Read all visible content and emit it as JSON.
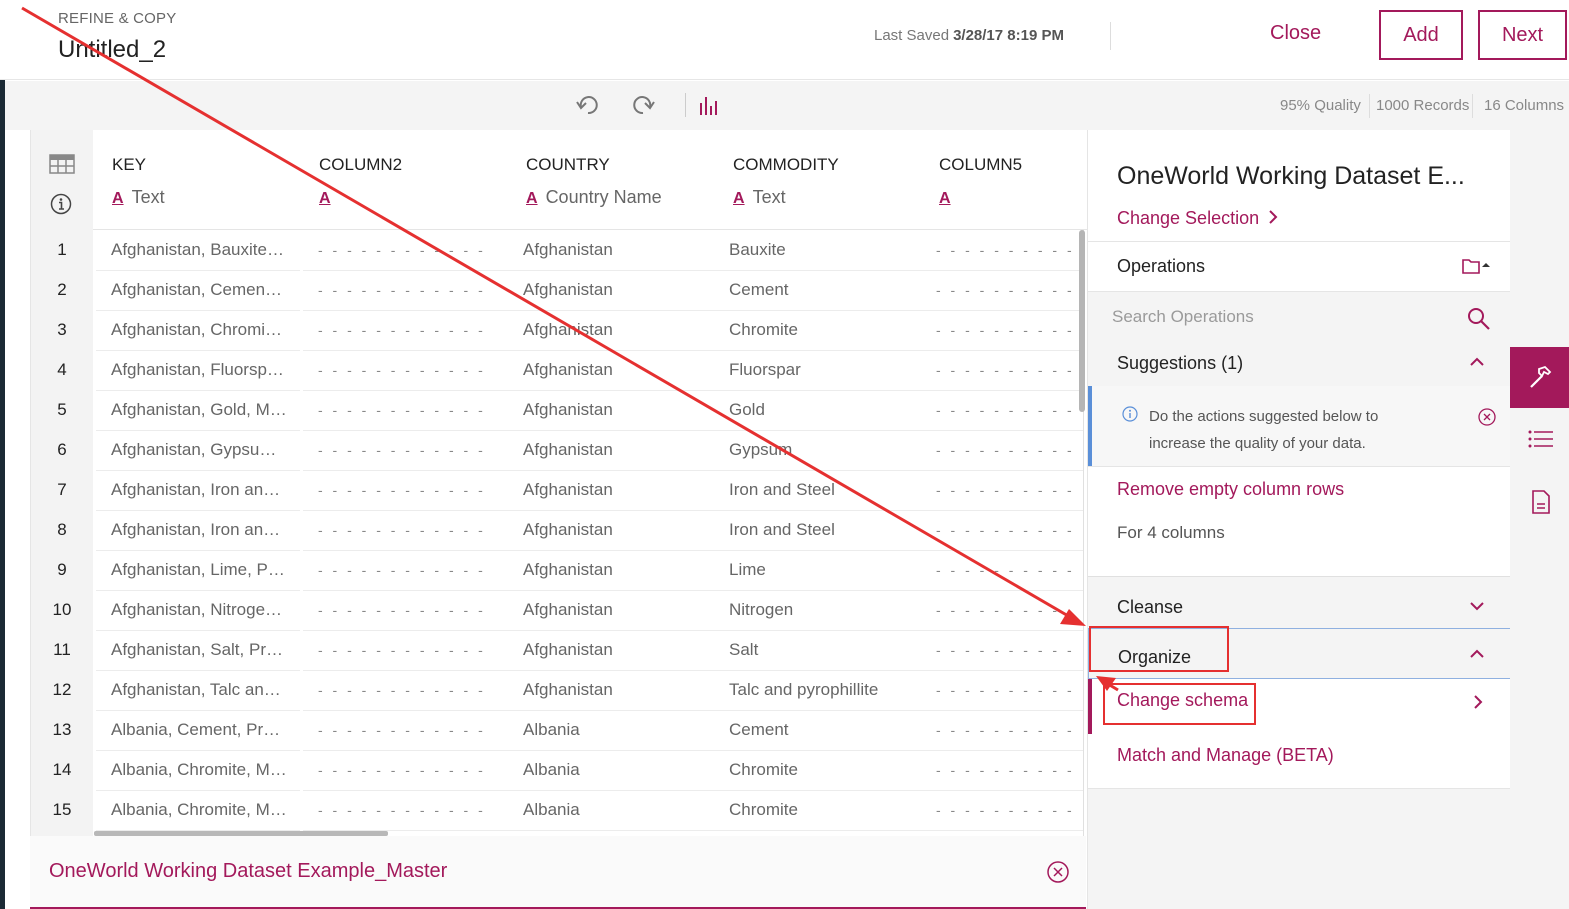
{
  "header": {
    "kicker": "REFINE & COPY",
    "title": "Untitled_2",
    "last_saved_label": "Last Saved",
    "last_saved_value": "3/28/17 8:19 PM",
    "close_label": "Close",
    "add_label": "Add",
    "next_label": "Next"
  },
  "toolbar": {
    "undo_icon": "undo-icon",
    "redo_icon": "redo-icon",
    "chart_icon": "bar-chart-icon",
    "quality": "95% Quality",
    "records": "1000 Records",
    "columns": "16 Columns"
  },
  "table": {
    "columns": [
      {
        "name": "KEY",
        "glyph": "A",
        "type": "Text"
      },
      {
        "name": "COLUMN2",
        "glyph": "A",
        "type": ""
      },
      {
        "name": "COUNTRY",
        "glyph": "A",
        "type": "Country Name"
      },
      {
        "name": "COMMODITY",
        "glyph": "A",
        "type": "Text"
      },
      {
        "name": "COLUMN5",
        "glyph": "A",
        "type": ""
      }
    ],
    "rows": [
      {
        "n": "1",
        "key": "Afghanistan, Bauxite…",
        "col2": "- - - - - - - - - - - - - -",
        "country": "Afghanistan",
        "commodity": "Bauxite",
        "col5": "- - - - - - - - - - - - -"
      },
      {
        "n": "2",
        "key": "Afghanistan, Cemen…",
        "col2": "- - - - - - - - - - - - - -",
        "country": "Afghanistan",
        "commodity": "Cement",
        "col5": "- - - - - - - - - - - - -"
      },
      {
        "n": "3",
        "key": "Afghanistan, Chromi…",
        "col2": "- - - - - - - - - - - - - -",
        "country": "Afghanistan",
        "commodity": "Chromite",
        "col5": "- - - - - - - - - - - - -"
      },
      {
        "n": "4",
        "key": "Afghanistan, Fluorsp…",
        "col2": "- - - - - - - - - - - - - -",
        "country": "Afghanistan",
        "commodity": "Fluorspar",
        "col5": "- - - - - - - - - - - - -"
      },
      {
        "n": "5",
        "key": "Afghanistan, Gold, M…",
        "col2": "- - - - - - - - - - - - - -",
        "country": "Afghanistan",
        "commodity": "Gold",
        "col5": "- - - - - - - - - - - - -"
      },
      {
        "n": "6",
        "key": "Afghanistan, Gypsu…",
        "col2": "- - - - - - - - - - - - - -",
        "country": "Afghanistan",
        "commodity": "Gypsum",
        "col5": "- - - - - - - - - - - - -"
      },
      {
        "n": "7",
        "key": "Afghanistan, Iron an…",
        "col2": "- - - - - - - - - - - - - -",
        "country": "Afghanistan",
        "commodity": "Iron and Steel",
        "col5": "- - - - - - - - - - - - -"
      },
      {
        "n": "8",
        "key": "Afghanistan, Iron an…",
        "col2": "- - - - - - - - - - - - - -",
        "country": "Afghanistan",
        "commodity": "Iron and Steel",
        "col5": "- - - - - - - - - - - - -"
      },
      {
        "n": "9",
        "key": "Afghanistan, Lime, P…",
        "col2": "- - - - - - - - - - - - - -",
        "country": "Afghanistan",
        "commodity": "Lime",
        "col5": "- - - - - - - - - - - - -"
      },
      {
        "n": "10",
        "key": "Afghanistan, Nitroge…",
        "col2": "- - - - - - - - - - - - - -",
        "country": "Afghanistan",
        "commodity": "Nitrogen",
        "col5": "- - - - - - - - - - - - -"
      },
      {
        "n": "11",
        "key": "Afghanistan, Salt, Pr…",
        "col2": "- - - - - - - - - - - - - -",
        "country": "Afghanistan",
        "commodity": "Salt",
        "col5": "- - - - - - - - - - - - -"
      },
      {
        "n": "12",
        "key": "Afghanistan, Talc an…",
        "col2": "- - - - - - - - - - - - - -",
        "country": "Afghanistan",
        "commodity": "Talc and pyrophillite",
        "col5": "- - - - - - - - - - - - -"
      },
      {
        "n": "13",
        "key": "Albania, Cement, Pr…",
        "col2": "- - - - - - - - - - - - - -",
        "country": "Albania",
        "commodity": "Cement",
        "col5": "- - - - - - - - - - - - -"
      },
      {
        "n": "14",
        "key": "Albania, Chromite, M…",
        "col2": "- - - - - - - - - - - - - -",
        "country": "Albania",
        "commodity": "Chromite",
        "col5": "- - - - - - - - - - - - -"
      },
      {
        "n": "15",
        "key": "Albania, Chromite, M…",
        "col2": "- - - - - - - - - - - - - -",
        "country": "Albania",
        "commodity": "Chromite",
        "col5": "- - - - - - - - - - - - -"
      }
    ]
  },
  "bottom_bar": {
    "dataset_name": "OneWorld Working Dataset Example_Master"
  },
  "panel": {
    "title": "OneWorld Working Dataset E...",
    "change_selection": "Change Selection",
    "operations_label": "Operations",
    "search_placeholder": "Search Operations",
    "suggestions_label": "Suggestions (1)",
    "suggestion_text": "Do the actions suggested below to increase the quality of your data.",
    "suggestion_action": "Remove empty column rows",
    "suggestion_sub": "For 4 columns",
    "cleanse_label": "Cleanse",
    "organize_label": "Organize",
    "change_schema_label": "Change schema",
    "match_manage_label": "Match and Manage (BETA)"
  },
  "colors": {
    "accent": "#a3195b",
    "annotation": "#e53030",
    "info_border": "#5a8fd8"
  }
}
